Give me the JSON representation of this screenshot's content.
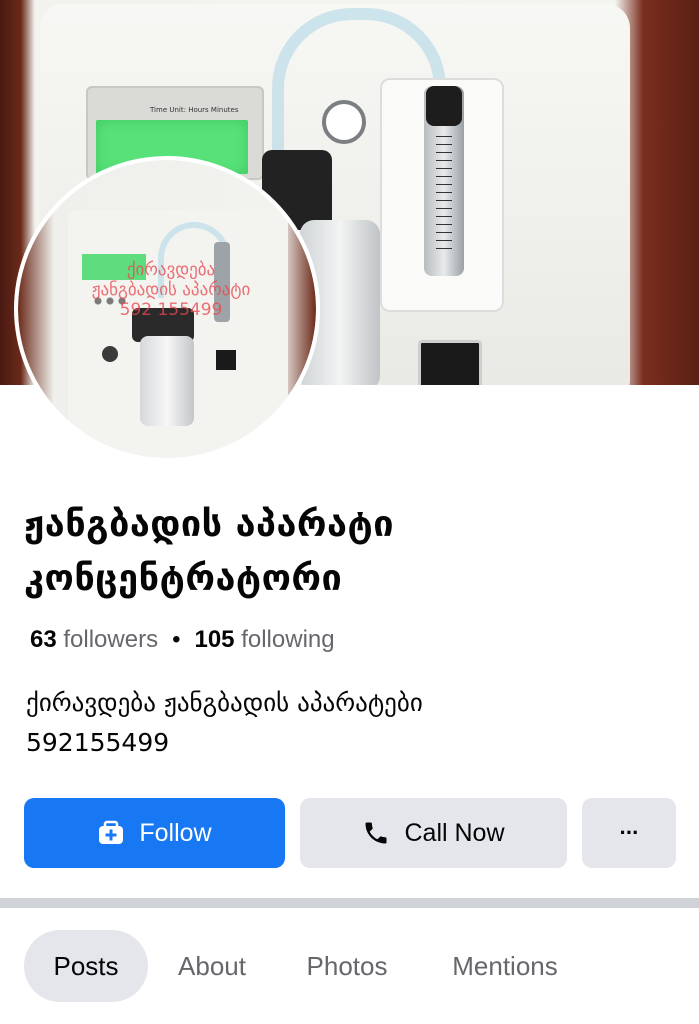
{
  "cover": {
    "device_screen_caption": "Time Unit: Hours  Minutes"
  },
  "profile_picture": {
    "watermark_lines": [
      "ქირავდება",
      "ჟანგბადის აპარატი",
      "592 155499"
    ]
  },
  "page": {
    "name": "ჟანგბადის აპარატი კონცენტრატორი",
    "followers_count": "63",
    "followers_label": "followers",
    "separator": "•",
    "following_count": "105",
    "following_label": "following",
    "bio_line1": "ქირავდება ჟანგბადის აპარატები",
    "bio_line2": "592155499"
  },
  "actions": {
    "follow_label": "Follow",
    "follow_icon": "follow-page-icon",
    "call_label": "Call Now",
    "call_icon": "phone-icon",
    "more_label": "···",
    "primary_color": "#1877f2",
    "secondary_color": "#e4e6eb"
  },
  "tabs": [
    {
      "label": "Posts",
      "active": true
    },
    {
      "label": "About",
      "active": false
    },
    {
      "label": "Photos",
      "active": false
    },
    {
      "label": "Mentions",
      "active": false
    }
  ]
}
